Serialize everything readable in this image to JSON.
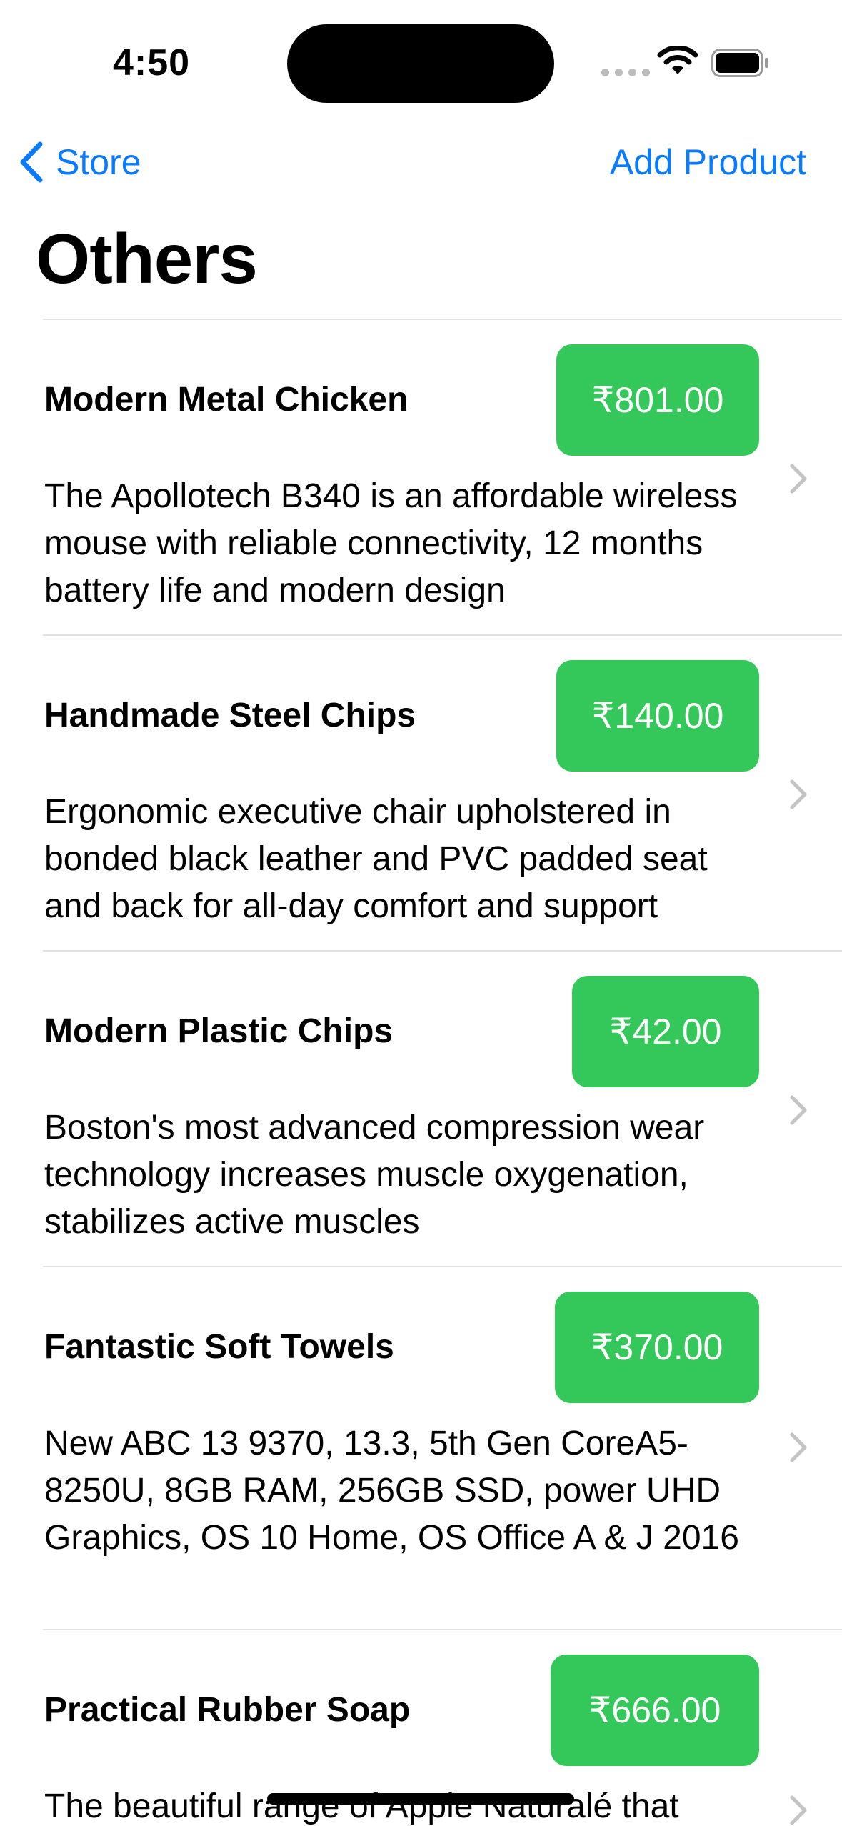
{
  "status_bar": {
    "time": "4:50"
  },
  "nav": {
    "back_label": "Store",
    "add_label": "Add Product"
  },
  "page": {
    "title": "Others"
  },
  "colors": {
    "accent": "#0a7aff",
    "price_bg": "#34c759"
  },
  "products": [
    {
      "name": "Modern Metal Chicken",
      "price": "₹801.00",
      "description": "The Apollotech B340 is an affordable wireless mouse with reliable connectivity, 12 months battery life and modern design"
    },
    {
      "name": "Handmade Steel Chips",
      "price": "₹140.00",
      "description": "Ergonomic executive chair upholstered in bonded black leather and PVC padded seat and back for all-day comfort and support"
    },
    {
      "name": "Modern Plastic Chips",
      "price": "₹42.00",
      "description": "Boston's most advanced compression wear technology increases muscle oxygenation, stabilizes active muscles"
    },
    {
      "name": "Fantastic Soft Towels",
      "price": "₹370.00",
      "description": "New ABC 13 9370, 13.3, 5th Gen CoreA5-8250U, 8GB RAM, 256GB SSD, power UHD Graphics, OS 10 Home, OS Office A & J 2016"
    },
    {
      "name": "Practical Rubber Soap",
      "price": "₹666.00",
      "description": "The beautiful range of Apple Naturalé that"
    }
  ]
}
